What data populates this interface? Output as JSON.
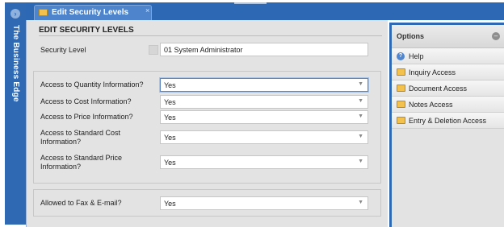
{
  "sidebar": {
    "title": "The Business Edge"
  },
  "tab": {
    "label": "Edit Security Levels",
    "close": "×"
  },
  "section": {
    "title": "EDIT SECURITY LEVELS"
  },
  "security_level": {
    "label": "Security Level",
    "value": "01 System Administrator"
  },
  "access_fields": [
    {
      "label": "Access to Quantity Information?",
      "value": "Yes"
    },
    {
      "label": "Access to Cost Information?",
      "value": "Yes"
    },
    {
      "label": "Access to Price Information?",
      "value": "Yes"
    },
    {
      "label": "Access to Standard Cost Information?",
      "value": "Yes"
    },
    {
      "label": "Access to Standard Price Information?",
      "value": "Yes"
    }
  ],
  "fax_email": {
    "label": "Allowed to Fax & E-mail?",
    "value": "Yes"
  },
  "options": {
    "title": "Options",
    "items": [
      {
        "label": "Help",
        "icon": "help-icon"
      },
      {
        "label": "Inquiry Access",
        "icon": "folder-icon"
      },
      {
        "label": "Document Access",
        "icon": "folder-icon"
      },
      {
        "label": "Notes Access",
        "icon": "folder-icon"
      },
      {
        "label": "Entry & Deletion Access",
        "icon": "folder-icon"
      }
    ]
  },
  "colors": {
    "accent": "#2f68b3",
    "panel": "#e3e3e3"
  }
}
